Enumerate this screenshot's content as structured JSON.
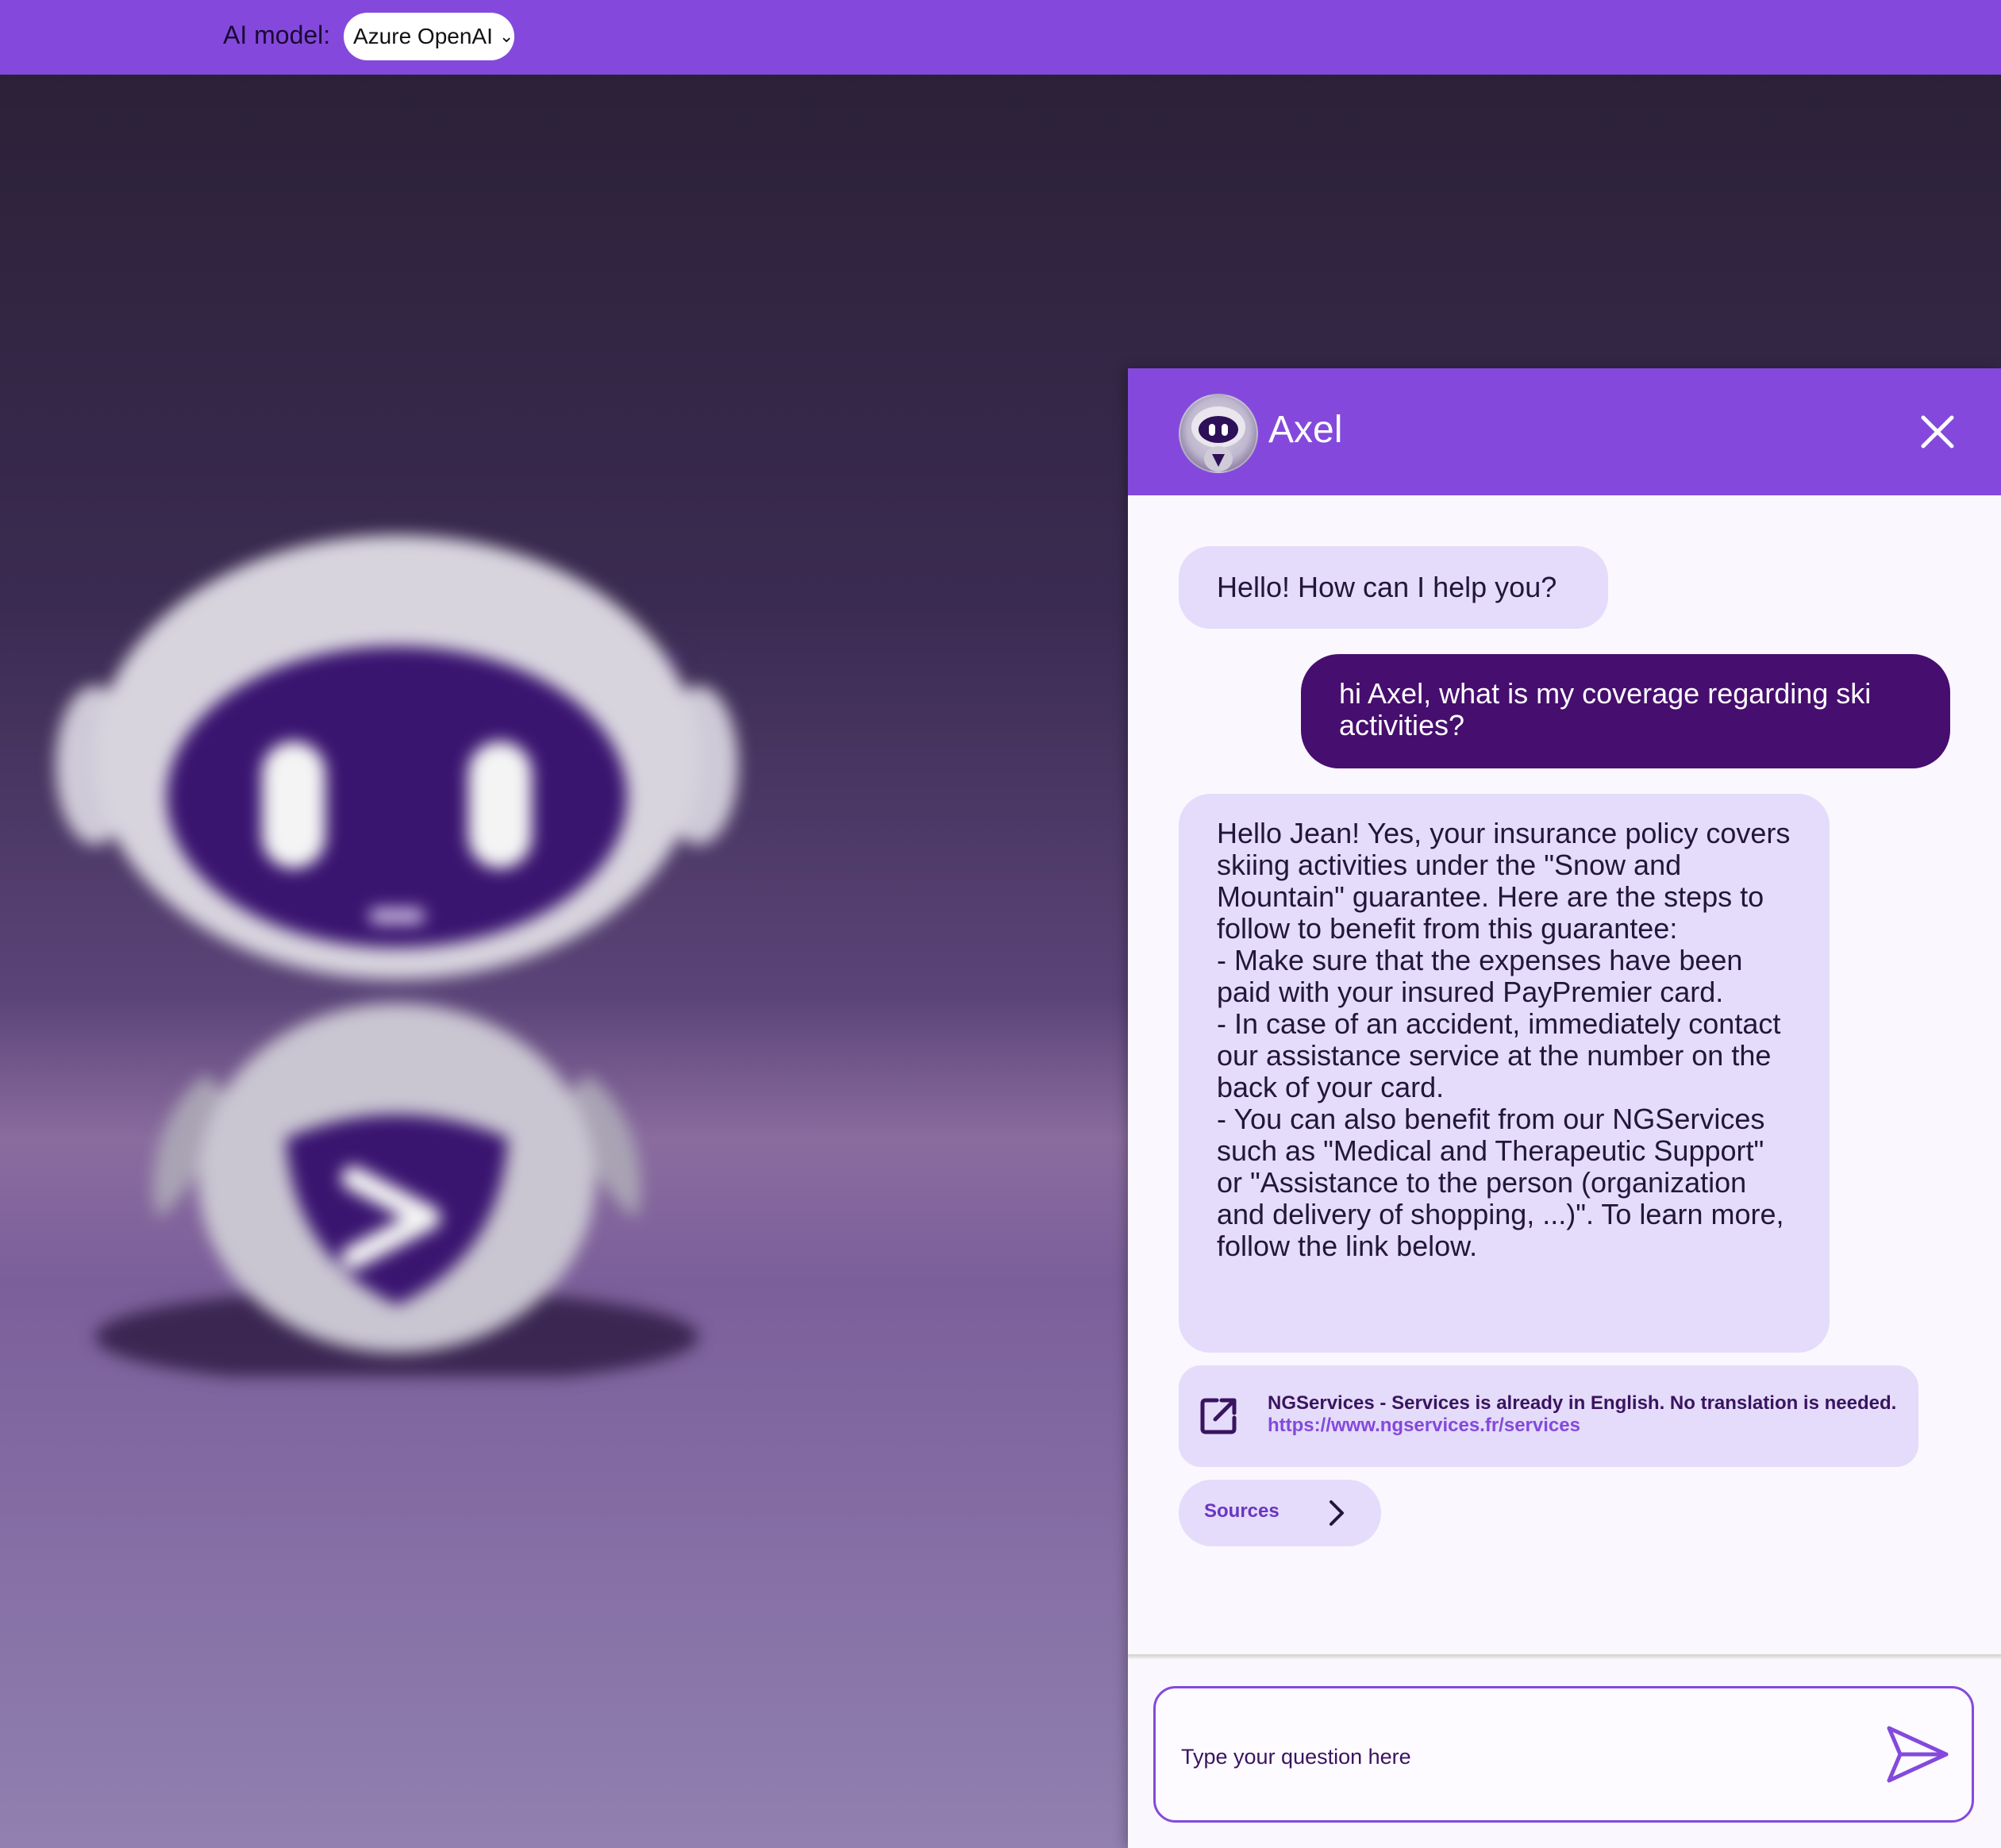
{
  "topbar": {
    "model_label": "AI model:",
    "model_selected": "Azure OpenAI",
    "brand_color": "#8449dc"
  },
  "chat": {
    "bot_name": "Axel",
    "messages": [
      {
        "role": "bot",
        "text": "Hello! How can I help you?"
      },
      {
        "role": "user",
        "text": "hi Axel, what is my coverage regarding ski activities?"
      },
      {
        "role": "bot",
        "text": "Hello Jean! Yes, your insurance policy covers skiing activities under the \"Snow and Mountain\" guarantee. Here are the steps to follow to benefit from this guarantee:\n- Make sure that the expenses have been paid with your insured PayPremier card.\n- In case of an accident, immediately contact our assistance service at the number on the back of your card.\n- You can also benefit from our NGServices such as \"Medical and Therapeutic Support\" or \"Assistance to the person (organization and delivery of shopping, ...)\". To learn more, follow the link below."
      }
    ],
    "link_card": {
      "title": "NGServices - Services is already in English. No translation is needed.",
      "url": "https://www.ngservices.fr/services"
    },
    "sources_label": "Sources",
    "input_placeholder": "Type your question here",
    "colors": {
      "bot_bubble": "#e4dcfa",
      "user_bubble": "#460e6e",
      "header": "#8449dc"
    }
  },
  "icons": {
    "close": "close-icon",
    "external_link": "external-link-icon",
    "chevron": "chevron-right-icon",
    "send": "send-icon",
    "select_chevron": "chevron-down-icon"
  }
}
